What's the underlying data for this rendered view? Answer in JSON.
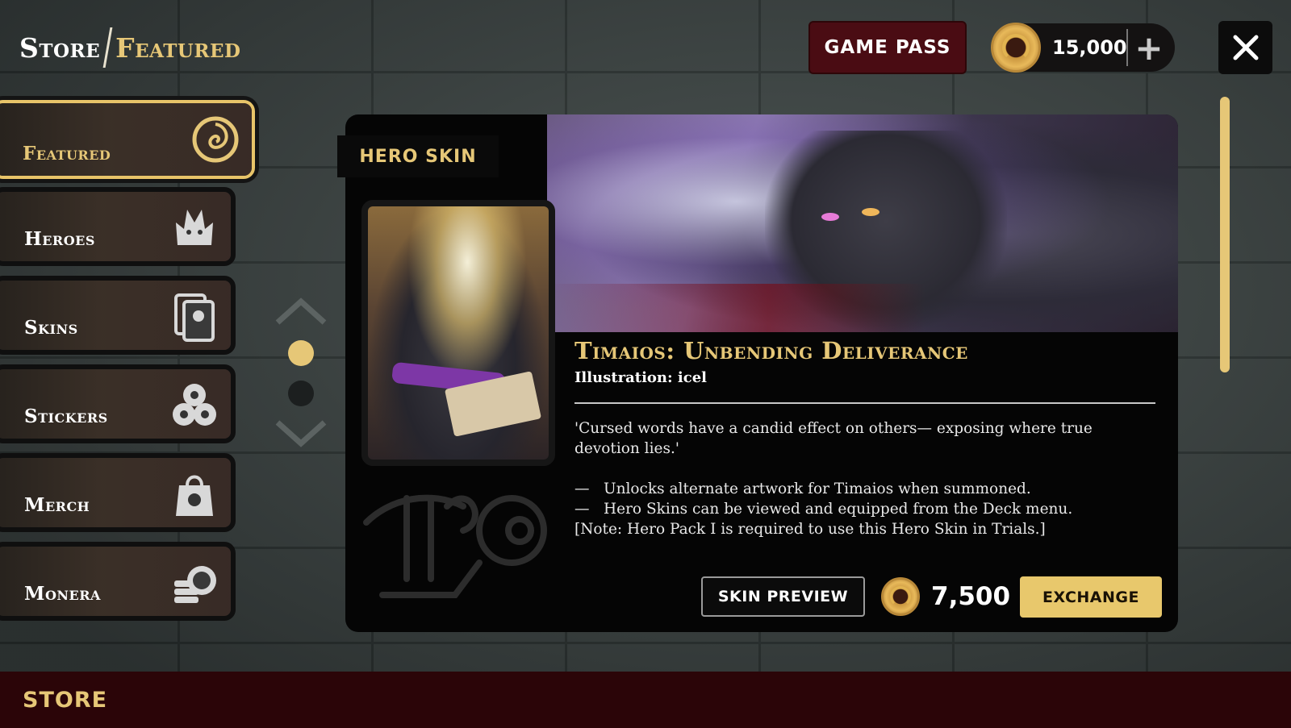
{
  "header": {
    "title_store": "Store",
    "title_section": "Featured",
    "game_pass_label": "GAME PASS",
    "currency_amount": "15,000",
    "currency_icon": "coin-icon",
    "add_icon": "plus-icon",
    "close_icon": "close-icon"
  },
  "sidebar": {
    "items": [
      {
        "label": "Featured",
        "icon": "swirl-emblem-icon",
        "active": true
      },
      {
        "label": "Heroes",
        "icon": "hero-mask-icon",
        "active": false
      },
      {
        "label": "Skins",
        "icon": "skin-card-icon",
        "active": false
      },
      {
        "label": "Stickers",
        "icon": "sticker-trio-icon",
        "active": false
      },
      {
        "label": "Merch",
        "icon": "merch-bag-icon",
        "active": false
      },
      {
        "label": "Monera",
        "icon": "monera-coin-stack-icon",
        "active": false
      }
    ],
    "carousel": {
      "up_icon": "chevron-up-icon",
      "down_icon": "chevron-down-icon",
      "page_count": 2,
      "current_page": 1
    }
  },
  "product": {
    "tag": "HERO SKIN",
    "name": "Timaios: Unbending Deliverance",
    "illustration": "Illustration: icel",
    "quote": "'Cursed words have a candid effect on others— exposing where true devotion lies.'",
    "bullets": [
      {
        "dash": "—",
        "text": "Unlocks alternate artwork for Timaios when summoned."
      },
      {
        "dash": "—",
        "text": "Hero Skins can be viewed and equipped from the Deck menu."
      }
    ],
    "note": "[Note: Hero Pack I is required to use this Hero Skin in Trials.]",
    "preview_label": "SKIN PREVIEW",
    "price": "7,500",
    "exchange_label": "EXCHANGE"
  },
  "footer": {
    "label": "STORE"
  },
  "colors": {
    "accent_gold": "#e6c777",
    "button_gold": "#e8c86c",
    "game_pass_bg": "#4a0c13",
    "footer_bg": "#2b0508",
    "card_bg": "#050505"
  }
}
